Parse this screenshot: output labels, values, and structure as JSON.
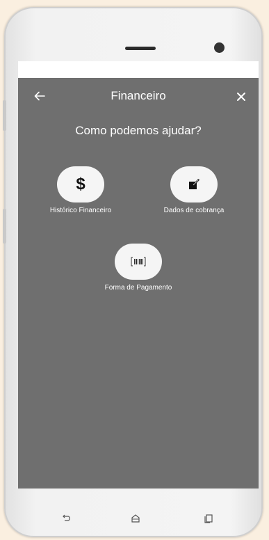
{
  "header": {
    "title": "Financeiro"
  },
  "main": {
    "subtitle": "Como podemos ajudar?",
    "options": [
      {
        "label": "Histórico Financeiro",
        "icon": "dollar-icon",
        "glyph": "$"
      },
      {
        "label": "Dados de cobrança",
        "icon": "edit-icon"
      },
      {
        "label": "Forma de Pagamento",
        "icon": "barcode-icon"
      }
    ]
  },
  "navigation": {
    "buttons": [
      "back",
      "home",
      "recent-apps"
    ]
  },
  "colors": {
    "screen_background": "#6f6f6f",
    "button_background": "#f5f5f5",
    "text": "#ffffff",
    "page_background": "#faefe0"
  }
}
